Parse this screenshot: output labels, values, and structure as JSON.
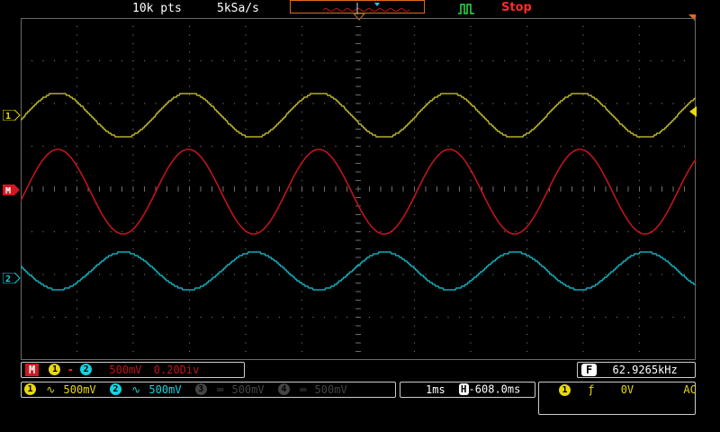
{
  "top": {
    "memory_depth": "10k pts",
    "sample_rate": "5kSa/s",
    "run_state": "Stop"
  },
  "channels": {
    "ch1": {
      "marker": "1",
      "color": "#b5ae2c"
    },
    "math": {
      "marker": "M",
      "color": "#c0141c"
    },
    "ch2": {
      "marker": "2",
      "color": "#12a8b4"
    }
  },
  "math_bar": {
    "label": "M",
    "src1": "1",
    "op": "-",
    "src2": "2",
    "scale": "500mV",
    "offset": "0.20Div"
  },
  "frequency": {
    "label": "F",
    "value": "62.9265kHz"
  },
  "channel_bar": {
    "ch1_label": "1",
    "ch1_scale": "500mV",
    "ch2_label": "2",
    "ch2_scale": "500mV",
    "ch3_label": "3",
    "ch3_scale": "500mV",
    "ch4_label": "4",
    "ch4_scale": "500mV"
  },
  "timebase": {
    "scale": "1ms",
    "h_label": "H",
    "offset": "-608.0ms"
  },
  "trigger": {
    "source": "1",
    "level": "0V",
    "coupling": "AC"
  },
  "colors": {
    "ch1": "#b5ae2c",
    "math": "#c0141c",
    "ch2": "#12a8b4",
    "grid": "#6a6a6a",
    "accent": "#e06b1f"
  }
}
